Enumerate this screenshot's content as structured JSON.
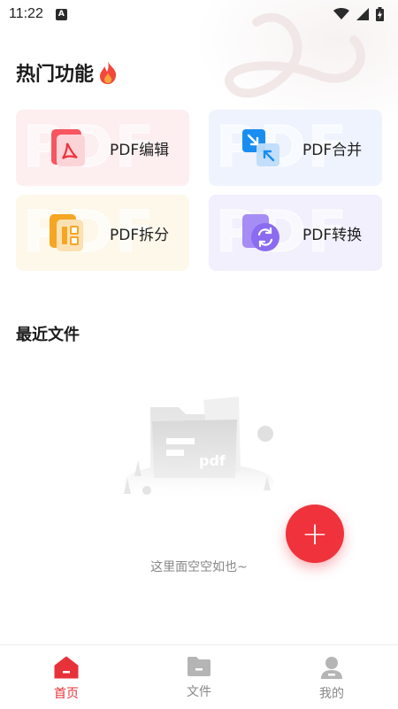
{
  "status_bar": {
    "time": "11:22",
    "notification_icon": "a-letter-icon",
    "icons": [
      "wifi-icon",
      "signal-icon",
      "battery-charging-icon"
    ]
  },
  "hot_section": {
    "title": "热门功能",
    "title_icon": "flame-icon"
  },
  "features": [
    {
      "label": "PDF编辑",
      "icon": "pdf-edit-icon",
      "watermark": "PDF",
      "color": "#f0323c"
    },
    {
      "label": "PDF合并",
      "icon": "pdf-merge-icon",
      "watermark": "PDF",
      "color": "#1a8ef0"
    },
    {
      "label": "PDF拆分",
      "icon": "pdf-split-icon",
      "watermark": "PDF",
      "color": "#f5a623"
    },
    {
      "label": "PDF转换",
      "icon": "pdf-convert-icon",
      "watermark": "PDF",
      "color": "#8b6cf0"
    }
  ],
  "recent_section": {
    "title": "最近文件",
    "empty_text": "这里面空空如也~",
    "illustration_label": "pdf"
  },
  "fab": {
    "label": "+",
    "icon": "plus-icon"
  },
  "bottom_nav": [
    {
      "label": "首页",
      "icon": "home-icon",
      "active": true
    },
    {
      "label": "文件",
      "icon": "folder-icon",
      "active": false
    },
    {
      "label": "我的",
      "icon": "profile-icon",
      "active": false
    }
  ],
  "colors": {
    "accent": "#f0323c",
    "inactive_nav": "#888888"
  }
}
